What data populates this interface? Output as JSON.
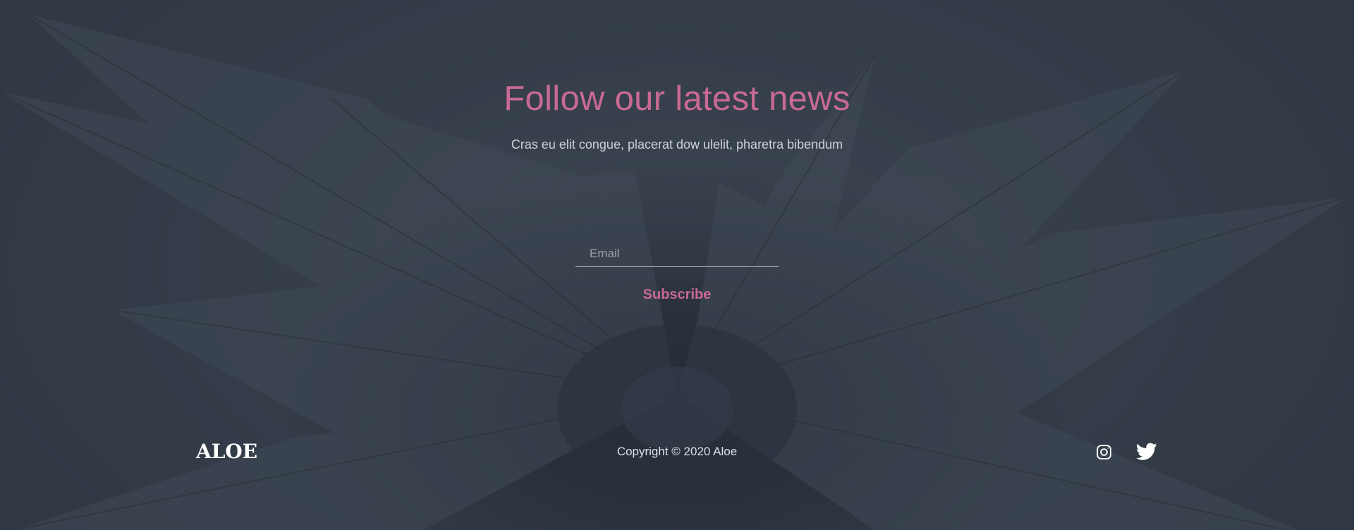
{
  "newsletter": {
    "title": "Follow our latest news",
    "subtitle": "Cras eu elit congue, placerat dow ulelit, pharetra bibendum",
    "email_placeholder": "Email",
    "subscribe_label": "Subscribe"
  },
  "footer": {
    "logo": "ALOE",
    "copyright": "Copyright © 2020 Aloe",
    "social": [
      {
        "icon": "instagram-icon"
      },
      {
        "icon": "twitter-icon"
      }
    ]
  },
  "colors": {
    "accent": "#c96a93",
    "background": "#3f4955",
    "text_light": "#dfe2e7"
  }
}
